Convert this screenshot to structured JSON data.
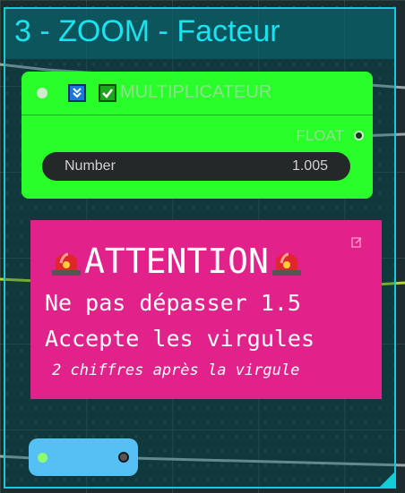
{
  "group": {
    "title": "3 - ZOOM - Facteur",
    "color": "#12cdd6"
  },
  "node": {
    "title": "MULTIPLICATEUR",
    "color": "#2afe2a",
    "icons": [
      "blue-arrows-icon",
      "checkmark-icon"
    ],
    "output_label": "FLOAT",
    "widget": {
      "name": "Number",
      "value": "1.005"
    }
  },
  "note": {
    "color": "#e0228a",
    "title": "ATTENTION",
    "title_icon": "siren-icon",
    "line1": "Ne pas dépasser 1.5",
    "line2": "Accepte les virgules",
    "small": "2 chiffres après la virgule"
  },
  "reroute": {
    "color": "#54c0f3"
  }
}
